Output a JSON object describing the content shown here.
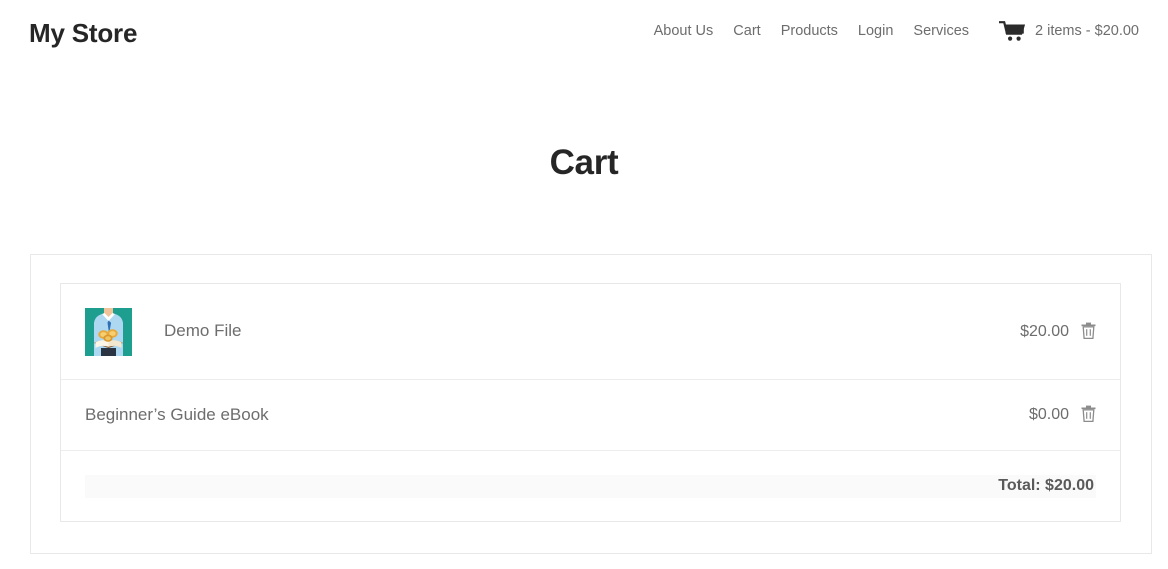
{
  "header": {
    "brand": "My Store",
    "nav": [
      {
        "label": "About Us"
      },
      {
        "label": "Cart"
      },
      {
        "label": "Products"
      },
      {
        "label": "Login"
      },
      {
        "label": "Services"
      }
    ],
    "cart_widget": {
      "icon": "shopping-cart-icon",
      "summary": "2 items - $20.00"
    }
  },
  "page": {
    "title": "Cart"
  },
  "cart": {
    "items": [
      {
        "name": "Demo File",
        "price": "$20.00",
        "has_thumbnail": true,
        "thumbnail_alt": "person-holding-book-with-coins",
        "remove_icon": "trash-icon"
      },
      {
        "name": "Beginner’s Guide eBook",
        "price": "$0.00",
        "has_thumbnail": false,
        "remove_icon": "trash-icon"
      }
    ],
    "total_label": "Total: $20.00"
  },
  "colors": {
    "text_dark": "#262626",
    "text_muted": "#6d6d6d",
    "border": "#e8e8e8",
    "band": "#fafafa",
    "thumb_bg": "#1d9e8e"
  }
}
